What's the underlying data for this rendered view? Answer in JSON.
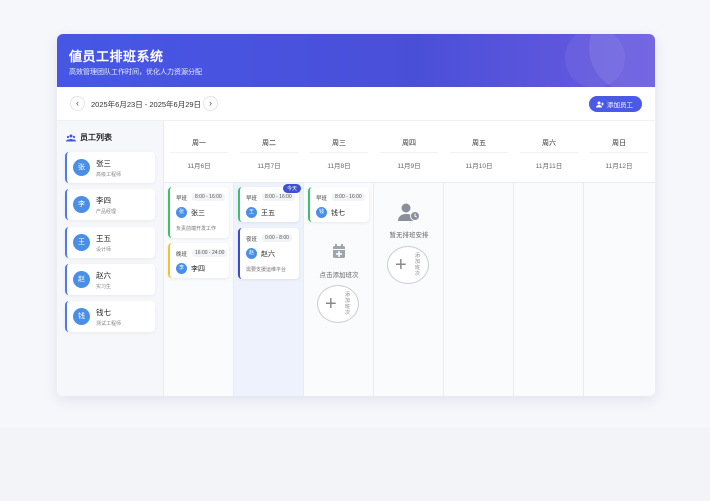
{
  "header": {
    "title": "値员工排班系统",
    "subtitle": "高效管理团队工作时间，优化人力资源分配"
  },
  "toolbar": {
    "prev_icon": "‹",
    "next_icon": "›",
    "date_range": "2025年6月23日 - 2025年6月29日",
    "add_employee_label": "添加员工"
  },
  "sidebar": {
    "title": "员工列表",
    "employees": [
      {
        "initial": "张",
        "name": "张三",
        "role": "高级工程师"
      },
      {
        "initial": "李",
        "name": "李四",
        "role": "产品经理"
      },
      {
        "initial": "王",
        "name": "王五",
        "role": "设计师"
      },
      {
        "initial": "赵",
        "name": "赵六",
        "role": "实习生"
      },
      {
        "initial": "钱",
        "name": "钱七",
        "role": "测试工程师"
      }
    ]
  },
  "days": [
    {
      "day": "周一",
      "date": "11月6日"
    },
    {
      "day": "周二",
      "date": "11月7日"
    },
    {
      "day": "周三",
      "date": "11月8日"
    },
    {
      "day": "周四",
      "date": "11月9日"
    },
    {
      "day": "周五",
      "date": "11月10日"
    },
    {
      "day": "周六",
      "date": "11月11日"
    },
    {
      "day": "周日",
      "date": "11月12日"
    }
  ],
  "today_badge": "今天",
  "shifts": {
    "mon": [
      {
        "type": "早班",
        "time": "8:00 - 16:00",
        "initial": "张",
        "name": "张三",
        "note": "负责前端开发工作",
        "color": "#3cc06a"
      },
      {
        "type": "晚班",
        "time": "16:00 - 24:00",
        "initial": "李",
        "name": "李四",
        "note": "",
        "color": "#f2c230"
      }
    ],
    "tue": [
      {
        "type": "早班",
        "time": "8:00 - 16:00",
        "initial": "王",
        "name": "王五",
        "note": "",
        "color": "#3cc06a"
      },
      {
        "type": "夜班",
        "time": "0:00 - 8:00",
        "initial": "赵",
        "name": "赵六",
        "note": "需要支援运维平台",
        "color": "#3b4ad0"
      }
    ],
    "wed": [
      {
        "type": "早班",
        "time": "8:00 - 16:00",
        "initial": "钱",
        "name": "钱七",
        "note": "",
        "color": "#3cc06a"
      }
    ]
  },
  "wed_hint": "点击添加班次",
  "thu_empty": "暂无排班安排",
  "add_shift_label": "添加班次",
  "colors": {
    "accent": "#4a5ae6",
    "avatar": "#4a8fe6"
  }
}
